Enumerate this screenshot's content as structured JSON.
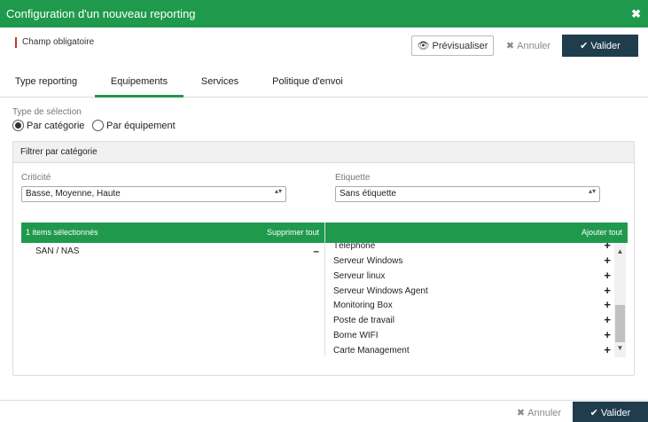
{
  "dialog": {
    "title": "Configuration d'un nouveau reporting",
    "close_icon": "✖"
  },
  "required_note": "Champ obligatoire",
  "buttons": {
    "preview_icon": "👁",
    "preview": "Prévisualiser",
    "cancel_icon": "✖",
    "cancel": "Annuler",
    "validate_icon": "✔",
    "validate": "Valider"
  },
  "tabs": [
    {
      "label": "Type reporting"
    },
    {
      "label": "Equipements"
    },
    {
      "label": "Services"
    },
    {
      "label": "Politique d'envoi"
    }
  ],
  "selection": {
    "label": "Type de sélection",
    "options": [
      {
        "label": "Par catégorie",
        "checked": true
      },
      {
        "label": "Par équipement",
        "checked": false
      }
    ]
  },
  "filter": {
    "title": "Filtrer par catégorie",
    "criticite_label": "Criticité",
    "criticite_value": "Basse, Moyenne, Haute",
    "etiquette_label": "Etiquette",
    "etiquette_value": "Sans étiquette",
    "select_arrow": "▴▾"
  },
  "selected_list": {
    "header": "1 items sélectionnés",
    "remove_all": "Supprimer tout",
    "remove_icon": "–",
    "items": [
      "SAN / NAS"
    ]
  },
  "available_list": {
    "add_all": "Ajouter tout",
    "add_icon": "+",
    "items": [
      "Téléphone",
      "Serveur Windows",
      "Serveur linux",
      "Serveur Windows Agent",
      "Monitoring Box",
      "Poste de travail",
      "Borne WIFI",
      "Carte Management"
    ],
    "scroll_up_icon": "▲",
    "scroll_down_icon": "▼"
  },
  "colors": {
    "brand_green": "#1f9a4d",
    "dark_button": "#1f3d4d",
    "required_mark": "#c0392b"
  }
}
